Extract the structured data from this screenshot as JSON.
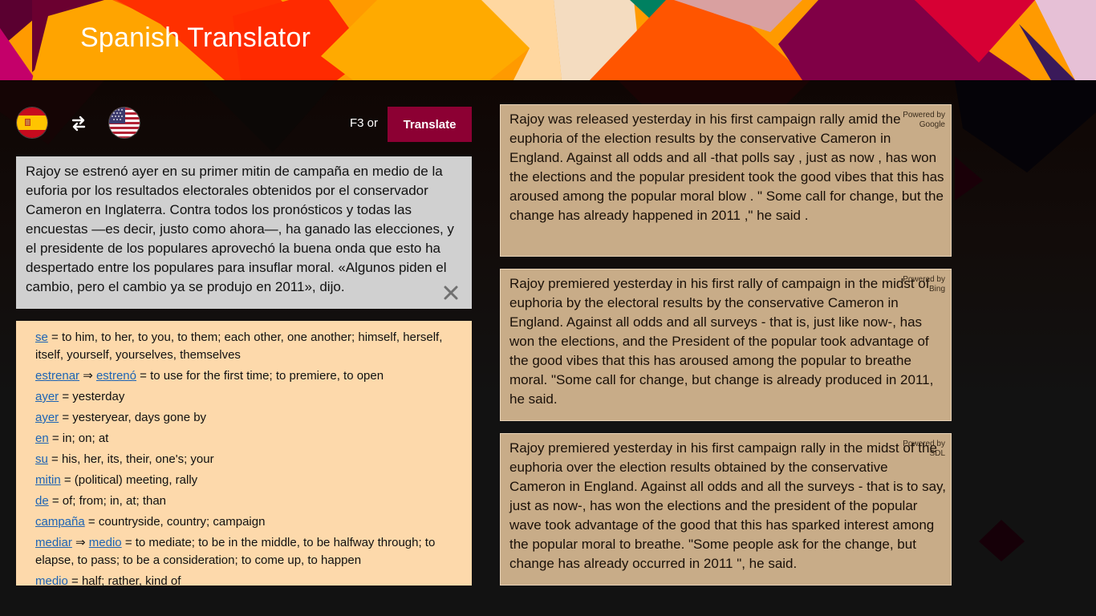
{
  "app": {
    "title": "Spanish Translator"
  },
  "toolbar": {
    "source_language": "Spanish",
    "source_flag": "spain-flag",
    "swap_icon": "swap-arrows-icon",
    "target_language": "English (US)",
    "target_flag": "usa-flag",
    "shortcut_hint": "F3 or",
    "translate_label": "Translate",
    "translate_color": "#8c0033"
  },
  "source": {
    "text": "Rajoy se estrenó ayer en su primer mitin de campaña en medio de la euforia por los resultados electorales obtenidos por el conservador Cameron en Inglaterra. Contra todos los pronósticos y todas las encuestas —es decir, justo como ahora—, ha ganado las elecciones, y el presidente de los populares aprovechó la buena onda que esto ha despertado entre los populares para insuflar moral. «Algunos piden el cambio, pero el cambio ya se produjo en 2011», dijo.",
    "clear_icon": "close-icon"
  },
  "dictionary": {
    "link_color": "#1e64b4",
    "entries": [
      {
        "base": "",
        "word": "se",
        "definition": "to him, to her, to you, to them; each other, one another; himself, herself, itself, yourself, yourselves, themselves"
      },
      {
        "base": "estrenar",
        "word": "estrenó",
        "definition": "to use for the first time; to premiere, to open"
      },
      {
        "base": "",
        "word": "ayer",
        "definition": "yesterday"
      },
      {
        "base": "",
        "word": "ayer",
        "definition": "yesteryear, days gone by"
      },
      {
        "base": "",
        "word": "en",
        "definition": "in; on; at"
      },
      {
        "base": "",
        "word": "su",
        "definition": "his, her, its, their, one's; your"
      },
      {
        "base": "",
        "word": "mitin",
        "definition": "(political) meeting, rally"
      },
      {
        "base": "",
        "word": "de",
        "definition": "of; from; in, at; than"
      },
      {
        "base": "",
        "word": "campaña",
        "definition": "countryside, country; campaign"
      },
      {
        "base": "mediar",
        "word": "medio",
        "definition": "to mediate; to be in the middle, to be halfway through; to elapse, to pass; to be a consideration; to come up, to happen"
      },
      {
        "base": "",
        "word": "medio",
        "definition": "half; rather, kind of"
      }
    ],
    "arrow": "⇒",
    "equals": "="
  },
  "results": [
    {
      "provider_line1": "Powered by",
      "provider_line2": "Google",
      "text": "Rajoy was released yesterday in his first campaign rally amid the euphoria of the election results by the conservative Cameron in England. Against all odds and all -that polls say , just as now , has won the elections and the popular president took the good vibes that this has aroused among the popular moral blow . \" Some call for change, but the change has already happened in 2011 ,\" he said ."
    },
    {
      "provider_line1": "Powered by",
      "provider_line2": "Bing",
      "text": "Rajoy premiered yesterday in his first rally of campaign in the midst of euphoria by the electoral results by the conservative Cameron in England. Against all odds and all surveys - that is, just like now-, has won the elections, and the President of the popular took advantage of the good vibes that this has aroused among the popular to breathe moral. \"Some call for change, but change is already produced in 2011, he said."
    },
    {
      "provider_line1": "Powered by",
      "provider_line2": "SDL",
      "text": "Rajoy premiered yesterday in his first campaign rally in the midst of the euphoria over the election results obtained by the conservative Cameron in England. Against all odds and all the surveys - that is to say, just as now-, has won the elections and the president of the popular wave took advantage of the good that this has sparked interest among the popular moral to breathe. \"Some people ask for the change, but change has already occurred in 2011 \", he said."
    }
  ]
}
